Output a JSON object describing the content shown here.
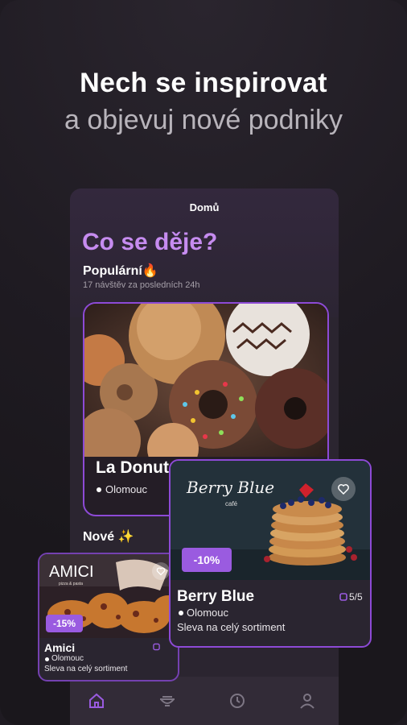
{
  "headline": {
    "line1": "Nech se inspirovat",
    "line2": "a objevuj nové podniky"
  },
  "phone": {
    "header_title": "Domů",
    "section_title": "Co se děje?",
    "popular": {
      "label": "Populární🔥",
      "subtitle": "17 návštěv za posledních 24h"
    },
    "featured": {
      "name": "La Donut",
      "city": "Olomouc"
    },
    "new_label": "Nové ✨",
    "tabs": [
      "home-icon",
      "dish-icon",
      "clock-icon",
      "profile-icon"
    ]
  },
  "cards": {
    "berry": {
      "logo": "Berry Blue",
      "logo_sub": "café",
      "discount": "-10%",
      "name": "Berry Blue",
      "count": "5/5",
      "city": "Olomouc",
      "desc": "Sleva na celý sortiment"
    },
    "amici": {
      "logo": "AMICI",
      "logo_sub": "pizza & pasta",
      "discount": "-15%",
      "name": "Amici",
      "city": "Olomouc",
      "desc": "Sleva na celý sortiment"
    }
  },
  "colors": {
    "accent": "#9a5be0",
    "title": "#c68cf0",
    "background": "#1f1b22"
  }
}
